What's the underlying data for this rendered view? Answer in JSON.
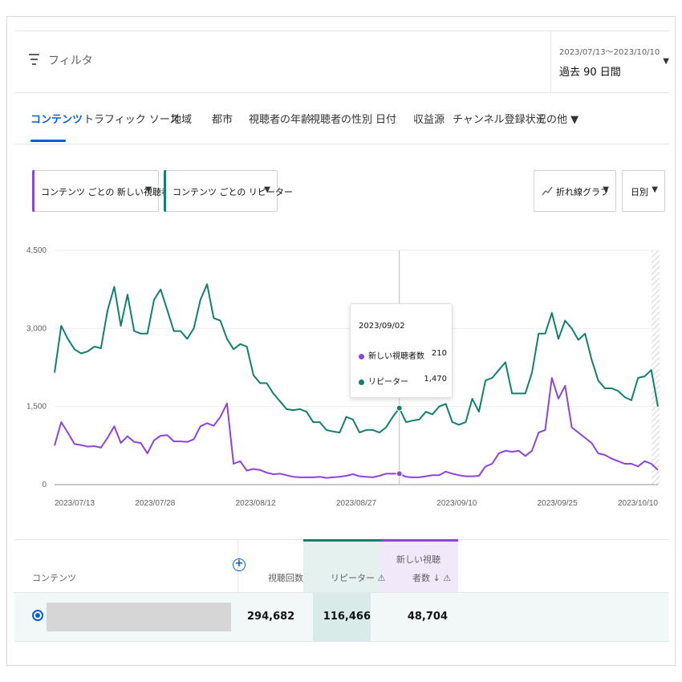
{
  "filter": {
    "icon": "filter-icon",
    "label": "フィルタ"
  },
  "date": {
    "range": "2023/07/13～2023/10/10",
    "label": "過去 90 日間"
  },
  "tabs": [
    {
      "label": "コンテンツ",
      "active": true
    },
    {
      "label": "トラフィック ソース"
    },
    {
      "label": "地域"
    },
    {
      "label": "都市"
    },
    {
      "label": "視聴者の年齢"
    },
    {
      "label": "視聴者の性別"
    },
    {
      "label": "日付"
    },
    {
      "label": "収益源"
    },
    {
      "label": "チャンネル登録状況"
    },
    {
      "label": "その他 ▼"
    }
  ],
  "selectors": {
    "metric1": {
      "label": "コンテンツ ごとの 新しい視聴者数",
      "color": "#8e44d9"
    },
    "metric2": {
      "label": "コンテンツ ごとの リピーター",
      "color": "#12806e"
    },
    "chart_type": {
      "label": "折れ線グラフ",
      "icon": "line-chart-icon"
    },
    "granularity": {
      "label": "日別"
    }
  },
  "colors": {
    "new_viewers": "#8e44d9",
    "repeaters": "#12806e",
    "accent": "#065fd4"
  },
  "chart_data": {
    "type": "line",
    "x_tick_labels": [
      "2023/07/13",
      "2023/07/28",
      "2023/08/12",
      "2023/08/27",
      "2023/09/10",
      "2023/09/25",
      "2023/10/10"
    ],
    "y_ticks": [
      "0",
      "1,500",
      "3,000",
      "4,500"
    ],
    "ylim": [
      0,
      4500
    ],
    "series": [
      {
        "name": "リピーター",
        "color": "#12806e",
        "values": [
          2150,
          3050,
          2800,
          2600,
          2520,
          2560,
          2650,
          2620,
          3350,
          3800,
          3050,
          3650,
          2950,
          2900,
          2900,
          3550,
          3750,
          3350,
          2950,
          2950,
          2800,
          3000,
          3550,
          3850,
          3200,
          3150,
          2800,
          2600,
          2700,
          2650,
          2100,
          1950,
          1950,
          1750,
          1600,
          1450,
          1430,
          1450,
          1400,
          1200,
          1200,
          1050,
          1020,
          1000,
          1300,
          1250,
          1000,
          1050,
          1050,
          1000,
          1100,
          1300,
          1470,
          1200,
          1230,
          1250,
          1400,
          1350,
          1500,
          1550,
          1200,
          1150,
          1200,
          1650,
          1400,
          2000,
          2050,
          2200,
          2350,
          1750,
          1750,
          1750,
          2150,
          2900,
          2900,
          3300,
          2800,
          3150,
          3000,
          2780,
          2900,
          2400,
          2000,
          1850,
          1850,
          1800,
          1680,
          1620,
          2050,
          2080,
          2200,
          1500
        ]
      },
      {
        "name": "新しい視聴者数",
        "color": "#8e44d9",
        "values": [
          750,
          1200,
          1000,
          780,
          760,
          730,
          740,
          710,
          900,
          1120,
          800,
          930,
          820,
          800,
          600,
          850,
          940,
          950,
          830,
          830,
          820,
          870,
          1120,
          1180,
          1130,
          1300,
          1560,
          400,
          450,
          270,
          300,
          280,
          230,
          200,
          210,
          180,
          150,
          140,
          140,
          140,
          150,
          130,
          140,
          150,
          170,
          200,
          160,
          150,
          140,
          170,
          210,
          210,
          210,
          150,
          140,
          140,
          160,
          180,
          180,
          250,
          210,
          180,
          160,
          160,
          170,
          350,
          400,
          600,
          650,
          630,
          650,
          550,
          650,
          1000,
          1050,
          2050,
          1650,
          1900,
          1100,
          1000,
          900,
          800,
          600,
          570,
          500,
          450,
          400,
          400,
          350,
          450,
          400,
          280
        ]
      }
    ],
    "tooltip": {
      "date": "2023/09/02",
      "index": 52
    }
  },
  "tooltip": {
    "date": "2023/09/02",
    "rows": [
      {
        "label": "新しい視聴者数",
        "value": "210"
      },
      {
        "label": "リピーター",
        "value": "1,470"
      }
    ]
  },
  "table": {
    "headers": {
      "content": "コンテンツ",
      "views": "視聴回数",
      "repeaters": "リピーター ⚠",
      "new_viewers_l1": "新しい視聴",
      "new_viewers_l2": "者数 ↓ ⚠"
    },
    "rows": [
      {
        "views": "294,682",
        "repeaters": "116,466",
        "new_viewers": "48,704"
      }
    ]
  }
}
